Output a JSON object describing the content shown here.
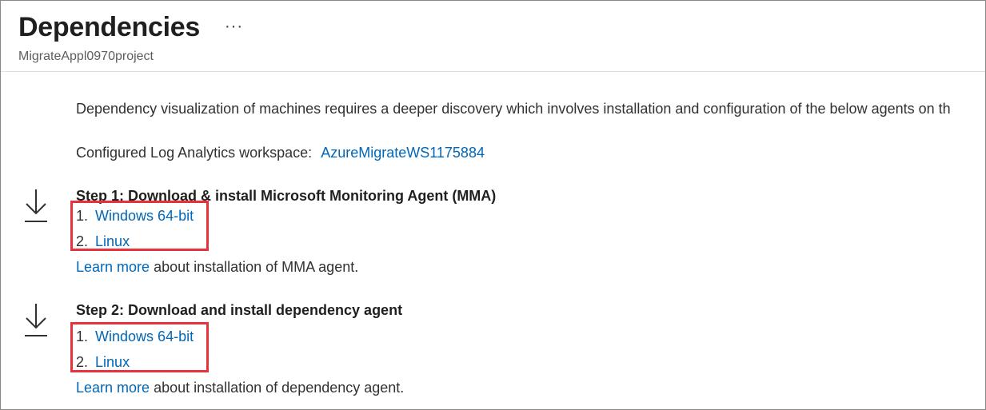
{
  "header": {
    "title": "Dependencies",
    "more": "···",
    "subtitle": "MigrateAppl0970project"
  },
  "intro": {
    "text": "Dependency visualization of machines requires a deeper discovery which involves installation and configuration of the below agents on th"
  },
  "workspace": {
    "label": "Configured Log Analytics workspace:",
    "link": "AzureMigrateWS1175884"
  },
  "steps": [
    {
      "title": "Step 1: Download & install Microsoft Monitoring Agent (MMA)",
      "items": [
        {
          "number": "1.",
          "label": "Windows 64-bit"
        },
        {
          "number": "2.",
          "label": "Linux"
        }
      ],
      "learn_more_link": "Learn more",
      "learn_more_text": " about installation of MMA agent."
    },
    {
      "title": "Step 2: Download and install dependency agent",
      "items": [
        {
          "number": "1.",
          "label": "Windows 64-bit"
        },
        {
          "number": "2.",
          "label": "Linux"
        }
      ],
      "learn_more_link": "Learn more",
      "learn_more_text": " about installation of dependency agent."
    }
  ],
  "colors": {
    "link": "#0067b8",
    "highlight": "#e8313b",
    "text": "#323130"
  }
}
